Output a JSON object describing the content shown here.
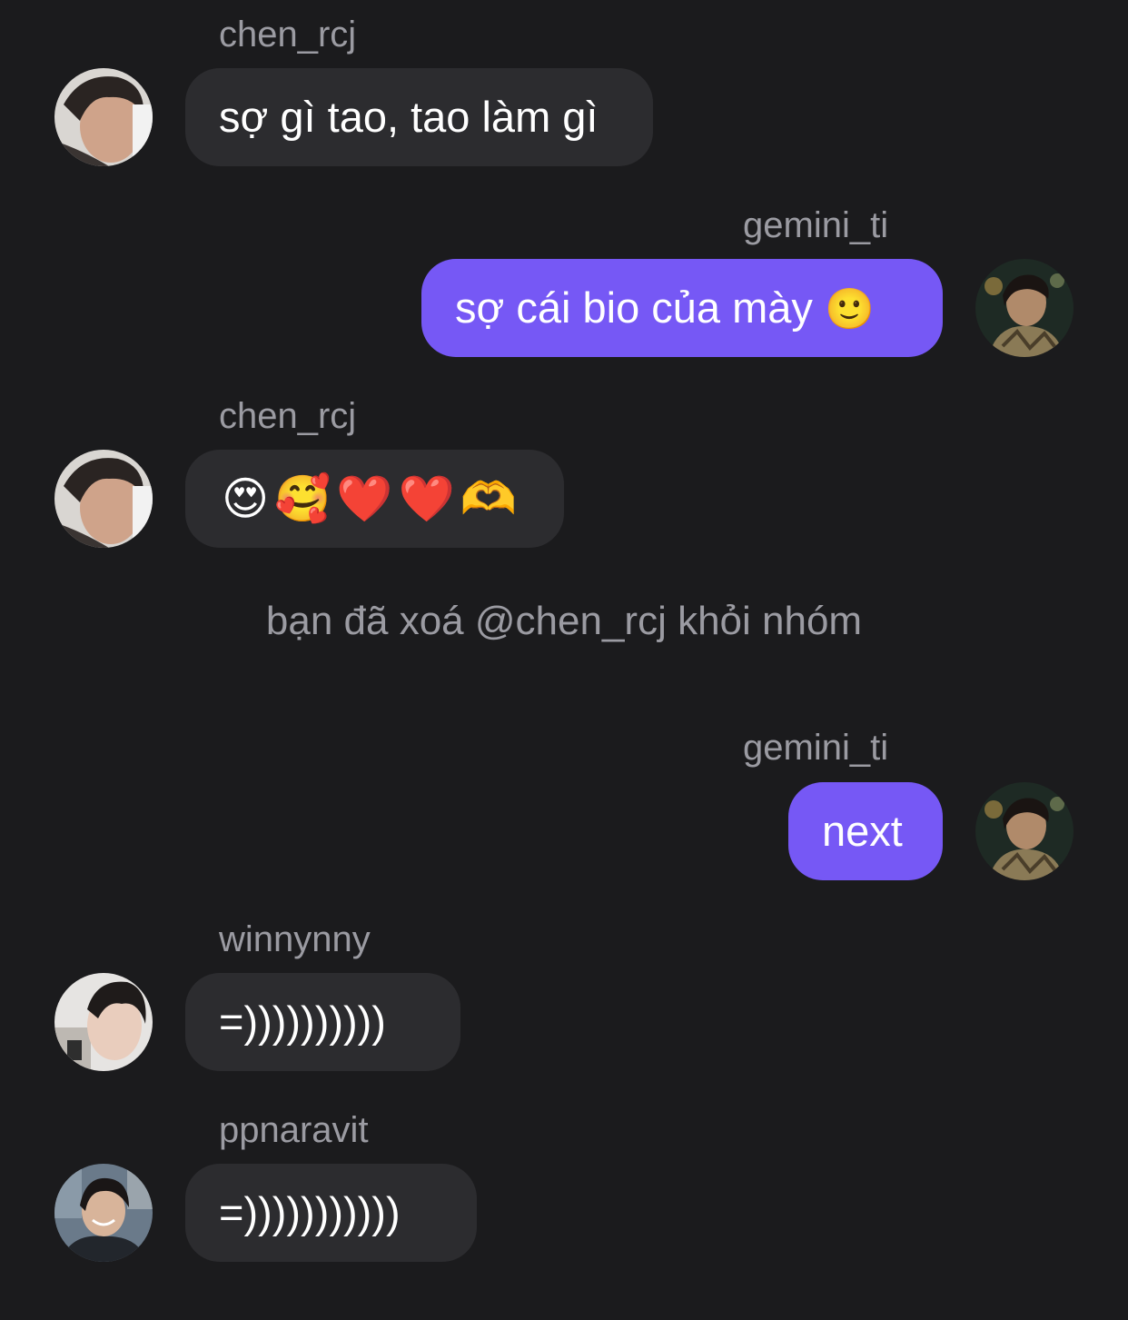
{
  "conversation": {
    "messages": [
      {
        "sender": "chen_rcj",
        "direction": "incoming",
        "text": "sợ gì tao, tao làm gì",
        "avatar_icon": "user-avatar-chen-rcj"
      },
      {
        "sender": "gemini_ti",
        "direction": "outgoing",
        "text": "sợ cái bio của mày",
        "emoji": "🙂",
        "avatar_icon": "user-avatar-gemini-ti"
      },
      {
        "sender": "chen_rcj",
        "direction": "incoming",
        "text": "😍🥰❤️❤️🫶",
        "avatar_icon": "user-avatar-chen-rcj"
      },
      {
        "sender": "gemini_ti",
        "direction": "outgoing",
        "text": "next",
        "avatar_icon": "user-avatar-gemini-ti"
      },
      {
        "sender": "winnynny",
        "direction": "incoming",
        "text": "=))))))))))",
        "avatar_icon": "user-avatar-winnynny"
      },
      {
        "sender": "ppnaravit",
        "direction": "incoming",
        "text": "=)))))))))))",
        "avatar_icon": "user-avatar-ppnaravit"
      }
    ],
    "system_notice": "bạn đã xoá @chen_rcj khỏi nhóm"
  },
  "colors": {
    "background": "#1b1b1d",
    "incoming_bubble": "#2c2c2f",
    "outgoing_bubble": "#7658f5",
    "sender_name": "#9b9ba2",
    "message_text": "#ffffff"
  }
}
